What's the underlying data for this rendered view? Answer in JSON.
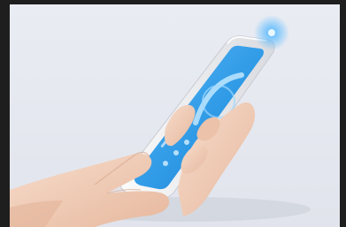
{
  "scene": {
    "subject": "hand-holding-smartphone",
    "colors": {
      "background": "#e6e9f1",
      "frame": "#1e1e1e",
      "screen": "#2f9ae6",
      "screen_light": "#8fd0ff",
      "phone_body": "#f2f2f2",
      "skin": "#f1cfba",
      "skin_shadow": "#d9a88e",
      "ir_glow": "#4fb7ff"
    },
    "icons": [
      "infrared-signal-icon",
      "gauge-icon"
    ]
  }
}
